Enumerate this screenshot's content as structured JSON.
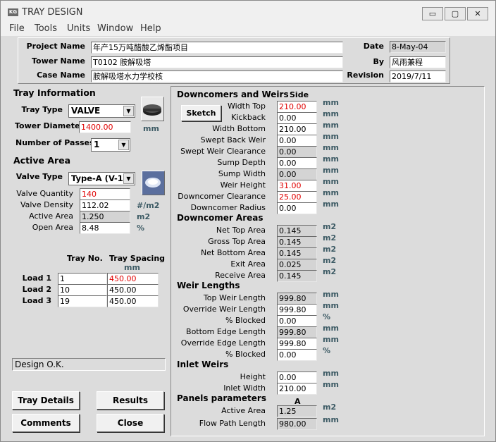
{
  "window": {
    "title": "TRAY DESIGN",
    "icon_text": "KG",
    "controls": {
      "minimize": "▭",
      "maximize": "▢",
      "close": "✕"
    }
  },
  "menu": [
    "File",
    "Tools",
    "Units",
    "Window",
    "Help"
  ],
  "header": {
    "project_label": "Project Name",
    "project_value": "年产15万吨醋酸乙烯酯项目",
    "tower_label": "Tower Name",
    "tower_value": "T0102 胺解吸塔",
    "case_label": "Case Name",
    "case_value": "胺解吸塔水力学校核",
    "date_label": "Date",
    "date_value": "8-May-04",
    "by_label": "By",
    "by_value": "风雨兼程",
    "revision_label": "Revision",
    "revision_value": "2019/7/11"
  },
  "tray_info": {
    "heading": "Tray Information",
    "type_label": "Tray Type",
    "type_value": "VALVE",
    "diameter_label": "Tower Diameter",
    "diameter_value": "1400.00",
    "diameter_unit": "mm",
    "passes_label": "Number of Passes",
    "passes_value": "1"
  },
  "active_area": {
    "heading": "Active Area",
    "valve_type_label": "Valve Type",
    "valve_type_value": "Type-A (V-1)",
    "rows": [
      {
        "label": "Valve Quantity",
        "value": "140",
        "unit": "",
        "red": true,
        "ro": false
      },
      {
        "label": "Valve Density",
        "value": "112.02",
        "unit": "#/m2",
        "red": false,
        "ro": false
      },
      {
        "label": "Active Area",
        "value": "1.250",
        "unit": "m2",
        "red": false,
        "ro": true
      },
      {
        "label": "Open Area",
        "value": "8.48",
        "unit": "%",
        "red": false,
        "ro": false
      }
    ]
  },
  "loads": {
    "tray_no_header": "Tray No.",
    "spacing_header": "Tray Spacing",
    "spacing_unit": "mm",
    "rows": [
      {
        "label": "Load 1",
        "tray": "1",
        "spacing": "450.00",
        "red": true
      },
      {
        "label": "Load 2",
        "tray": "10",
        "spacing": "450.00",
        "red": false
      },
      {
        "label": "Load 3",
        "tray": "19",
        "spacing": "450.00",
        "red": false
      }
    ]
  },
  "status": "Design O.K.",
  "buttons": {
    "details": "Tray Details",
    "results": "Results",
    "comments": "Comments",
    "close": "Close",
    "sketch": "Sketch"
  },
  "downcomers": {
    "heading": "Downcomers and Weirs",
    "side_header": "Side",
    "rows": [
      {
        "label": "Width Top",
        "value": "210.00",
        "unit": "mm",
        "red": true,
        "ro": false
      },
      {
        "label": "Kickback",
        "value": "0.00",
        "unit": "mm",
        "red": false,
        "ro": false
      },
      {
        "label": "Width Bottom",
        "value": "210.00",
        "unit": "mm",
        "red": false,
        "ro": false
      },
      {
        "label": "Swept Back Weir",
        "value": "0.00",
        "unit": "mm",
        "red": false,
        "ro": false
      },
      {
        "label": "Swept Weir Clearance",
        "value": "0.00",
        "unit": "mm",
        "red": false,
        "ro": true
      },
      {
        "label": "Sump Depth",
        "value": "0.00",
        "unit": "mm",
        "red": false,
        "ro": false
      },
      {
        "label": "Sump Width",
        "value": "0.00",
        "unit": "mm",
        "red": false,
        "ro": true
      },
      {
        "label": "Weir Height",
        "value": "31.00",
        "unit": "mm",
        "red": true,
        "ro": false
      },
      {
        "label": "Downcomer Clearance",
        "value": "25.00",
        "unit": "mm",
        "red": true,
        "ro": false
      },
      {
        "label": "Downcomer Radius",
        "value": "0.00",
        "unit": "mm",
        "red": false,
        "ro": false
      }
    ]
  },
  "downcomer_areas": {
    "heading": "Downcomer Areas",
    "rows": [
      {
        "label": "Net Top Area",
        "value": "0.145",
        "unit": "m2"
      },
      {
        "label": "Gross Top Area",
        "value": "0.145",
        "unit": "m2"
      },
      {
        "label": "Net Bottom Area",
        "value": "0.145",
        "unit": "m2"
      },
      {
        "label": "Exit Area",
        "value": "0.025",
        "unit": "m2"
      },
      {
        "label": "Receive Area",
        "value": "0.145",
        "unit": "m2"
      }
    ]
  },
  "weir_lengths": {
    "heading": "Weir Lengths",
    "rows": [
      {
        "label": "Top Weir Length",
        "value": "999.80",
        "unit": "mm",
        "ro": true
      },
      {
        "label": "Override Weir Length",
        "value": "999.80",
        "unit": "mm",
        "ro": false
      },
      {
        "label": "% Blocked",
        "value": "0.00",
        "unit": "%",
        "ro": false
      },
      {
        "label": "Bottom Edge Length",
        "value": "999.80",
        "unit": "mm",
        "ro": true
      },
      {
        "label": "Override Edge Length",
        "value": "999.80",
        "unit": "mm",
        "ro": false
      },
      {
        "label": "% Blocked",
        "value": "0.00",
        "unit": "%",
        "ro": false
      }
    ]
  },
  "inlet_weirs": {
    "heading": "Inlet Weirs",
    "rows": [
      {
        "label": "Height",
        "value": "0.00",
        "unit": "mm"
      },
      {
        "label": "Inlet Width",
        "value": "210.00",
        "unit": "mm"
      }
    ]
  },
  "panels": {
    "heading": "Panels parameters",
    "col_header": "A",
    "rows": [
      {
        "label": "Active Area",
        "value": "1.25",
        "unit": "m2"
      },
      {
        "label": "Flow Path Length",
        "value": "980.00",
        "unit": "mm"
      }
    ]
  },
  "colors": {
    "red_text": "#e00000",
    "unit_text": "#3c5a64",
    "background": "#dcdcdc"
  }
}
